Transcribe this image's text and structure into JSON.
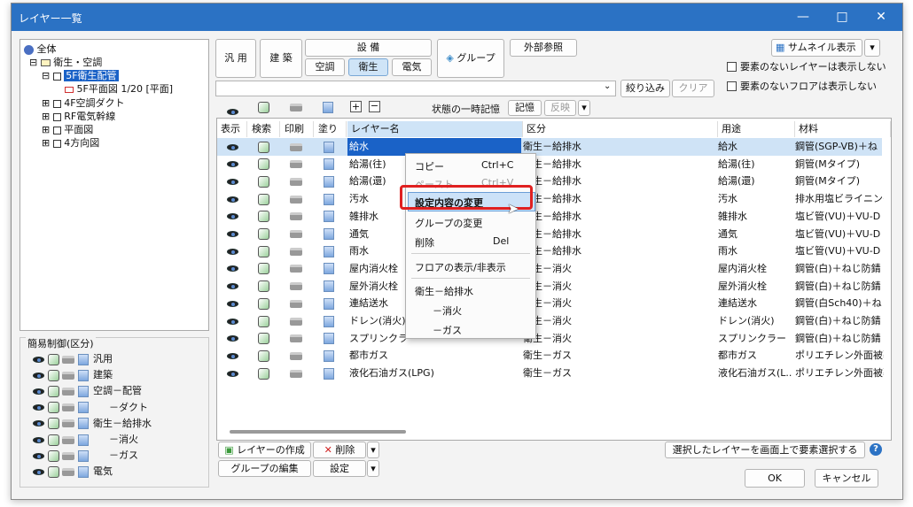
{
  "window": {
    "title": "レイヤー一覧",
    "minimize": "—",
    "maximize": "□",
    "close": "✕"
  },
  "tree": {
    "root": "全体",
    "nodes": [
      "衛生・空調",
      "5F衛生配管",
      "5F平面図 1/20 [平面]",
      "4F空調ダクト",
      "RF電気幹線",
      "平面図",
      "4方向図"
    ]
  },
  "simple_control": {
    "title": "簡易制御(区分)",
    "rows": [
      "汎用",
      "建築",
      "空調－配管",
      "－ダクト",
      "衛生－給排水",
      "－消火",
      "－ガス",
      "電気"
    ]
  },
  "toolbar": {
    "general": "汎 用",
    "arch": "建 築",
    "equipment": "設 備",
    "hvac": "空調",
    "sanitary": "衛生",
    "electric": "電気",
    "group": "グループ",
    "xref": "外部参照",
    "thumbnail": "サムネイル表示",
    "hide_empty_layers": "要素のないレイヤーは表示しない",
    "hide_empty_floors": "要素のないフロアは表示しない",
    "filter_value": "",
    "filter": "絞り込み",
    "clear": "クリア",
    "temp_state": "状態の一時記憶",
    "remember": "記憶",
    "apply": "反映"
  },
  "columns": [
    "表示",
    "検索",
    "印刷",
    "塗り",
    "レイヤー名",
    "区分",
    "用途",
    "材料"
  ],
  "rows": [
    {
      "name": "給水",
      "kubun": "衛生－給排水",
      "yoto": "給水",
      "zairyo": "鋼管(SGP-VB)＋ね"
    },
    {
      "name": "給湯(往)",
      "kubun": "衛生－給排水",
      "yoto": "給湯(往)",
      "zairyo": "銅管(Mタイプ)"
    },
    {
      "name": "給湯(還)",
      "kubun": "衛生－給排水",
      "yoto": "給湯(還)",
      "zairyo": "銅管(Mタイプ)"
    },
    {
      "name": "汚水",
      "kubun": "衛生－給排水",
      "yoto": "汚水",
      "zairyo": "排水用塩ビライニング"
    },
    {
      "name": "雑排水",
      "kubun": "衛生－給排水",
      "yoto": "雑排水",
      "zairyo": "塩ビ管(VU)＋VU-D"
    },
    {
      "name": "通気",
      "kubun": "衛生－給排水",
      "yoto": "通気",
      "zairyo": "塩ビ管(VU)＋VU-D"
    },
    {
      "name": "雨水",
      "kubun": "衛生－給排水",
      "yoto": "雨水",
      "zairyo": "塩ビ管(VU)＋VU-D"
    },
    {
      "name": "屋内消火栓",
      "kubun": "衛生－消火",
      "yoto": "屋内消火栓",
      "zairyo": "鋼管(白)＋ねじ防錆"
    },
    {
      "name": "屋外消火栓",
      "kubun": "衛生－消火",
      "yoto": "屋外消火栓",
      "zairyo": "鋼管(白)＋ねじ防錆"
    },
    {
      "name": "連結送水",
      "kubun": "衛生－消火",
      "yoto": "連結送水",
      "zairyo": "鋼管(白Sch40)＋ね"
    },
    {
      "name": "ドレン(消火)",
      "kubun": "衛生－消火",
      "yoto": "ドレン(消火)",
      "zairyo": "鋼管(白)＋ねじ防錆"
    },
    {
      "name": "スプリンクラー",
      "kubun": "衛生－消火",
      "yoto": "スプリンクラー",
      "zairyo": "鋼管(白)＋ねじ防錆"
    },
    {
      "name": "都市ガス",
      "kubun": "衛生－ガス",
      "yoto": "都市ガス",
      "zairyo": "ポリエチレン外面被覆"
    },
    {
      "name": "液化石油ガス(LPG)",
      "kubun": "衛生－ガス",
      "yoto": "液化石油ガス(L..",
      "zairyo": "ポリエチレン外面被覆"
    }
  ],
  "context_menu": {
    "copy": "コピー",
    "copy_sc": "Ctrl+C",
    "paste": "ペースト",
    "paste_sc": "Ctrl+V",
    "edit": "設定内容の変更",
    "group_change": "グループの変更",
    "delete": "削除",
    "delete_sc": "Del",
    "floor_toggle": "フロアの表示/非表示",
    "kyuhaisui": "衛生－給排水",
    "shoka": "－消火",
    "gas": "－ガス"
  },
  "bottom": {
    "create": "レイヤーの作成",
    "delete": "削除",
    "group_edit": "グループの編集",
    "settings": "設定",
    "select_on_screen": "選択したレイヤーを画面上で要素選択する",
    "ok": "OK",
    "cancel": "キャンセル",
    "help": "?"
  },
  "colors": {
    "titlebar": "#2b72c4",
    "selection": "#1a62c7",
    "highlight": "#e02020"
  }
}
